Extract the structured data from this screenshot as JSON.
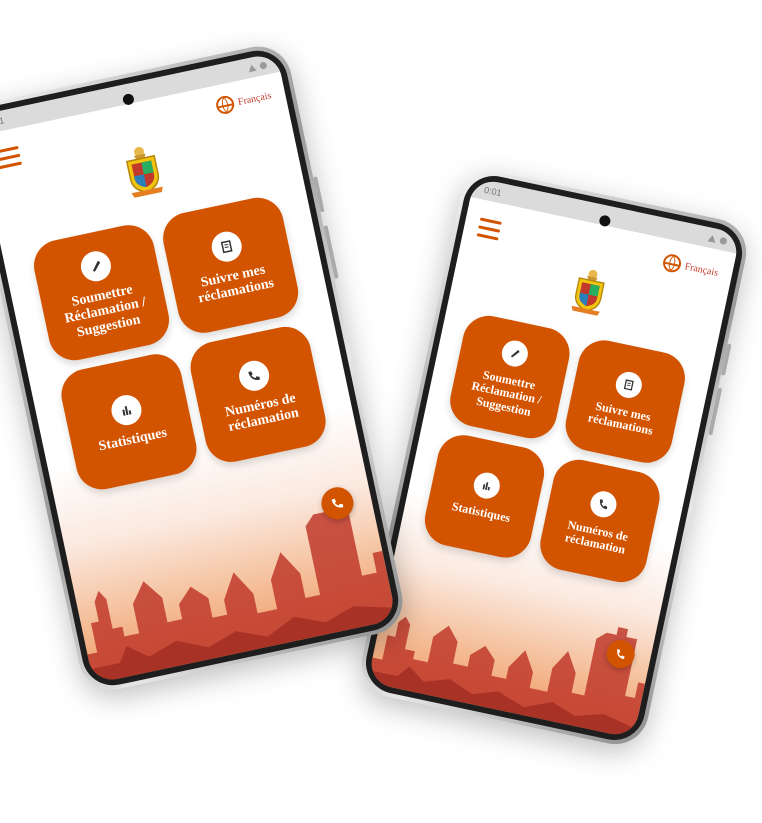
{
  "status_bar": {
    "time": "0:01"
  },
  "language": {
    "label": "Français"
  },
  "tiles": [
    {
      "label": "Soumettre Réclamation / Suggestion",
      "icon": "pencil-icon"
    },
    {
      "label": "Suivre mes réclamations",
      "icon": "document-icon"
    },
    {
      "label": "Statistiques",
      "icon": "bar-chart-icon"
    },
    {
      "label": "Numéros de réclamation",
      "icon": "phone-icon"
    }
  ],
  "colors": {
    "accent": "#d35400",
    "background": "#ffffff"
  }
}
